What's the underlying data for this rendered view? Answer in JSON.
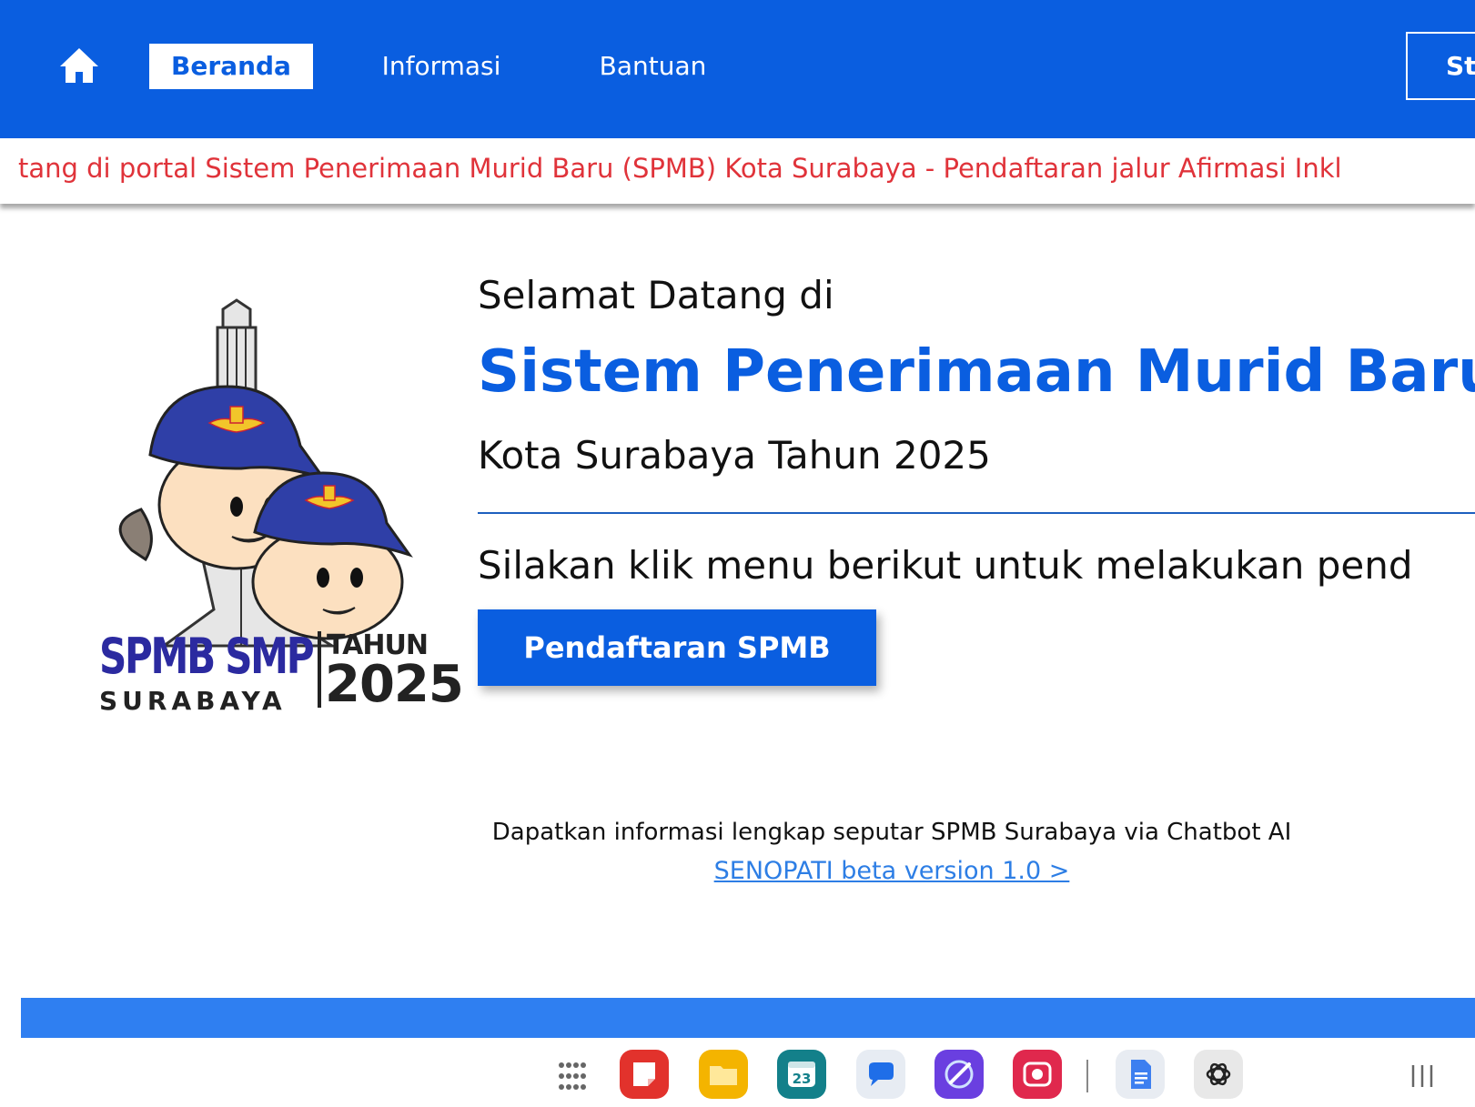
{
  "nav": {
    "home_icon": "home-icon",
    "items": [
      {
        "label": "Beranda",
        "active": true
      },
      {
        "label": "Informasi",
        "active": false
      },
      {
        "label": "Bantuan",
        "active": false
      }
    ],
    "right_button_label": "St",
    "bg_color": "#0a5ee0"
  },
  "marquee": {
    "text": "tang di portal Sistem Penerimaan Murid Baru (SPMB) Kota Surabaya - Pendaftaran jalur Afirmasi Inkl",
    "color": "#e0333a"
  },
  "logo": {
    "title_line1": "SPMB SMP",
    "title_line2": "SURABAYA",
    "tahun_label": "TAHUN",
    "year": "2025"
  },
  "hero": {
    "welcome": "Selamat Datang di",
    "system_title": "Sistem Penerimaan Murid Baru (",
    "city_year": "Kota Surabaya Tahun 2025",
    "instruction": "Silakan klik menu berikut untuk melakukan pend",
    "register_button": "Pendaftaran SPMB"
  },
  "chatbot": {
    "info": "Dapatkan informasi lengkap seputar SPMB Surabaya via Chatbot AI",
    "link": "SENOPATI beta version 1.0 >"
  },
  "taskbar": {
    "calendar_day": "23",
    "apps": [
      "app-drawer-icon",
      "notes-icon",
      "files-icon",
      "calendar-icon",
      "messages-icon",
      "internet-icon",
      "screen-recorder-icon",
      "docs-icon",
      "chatgpt-icon",
      "recents-icon"
    ]
  }
}
